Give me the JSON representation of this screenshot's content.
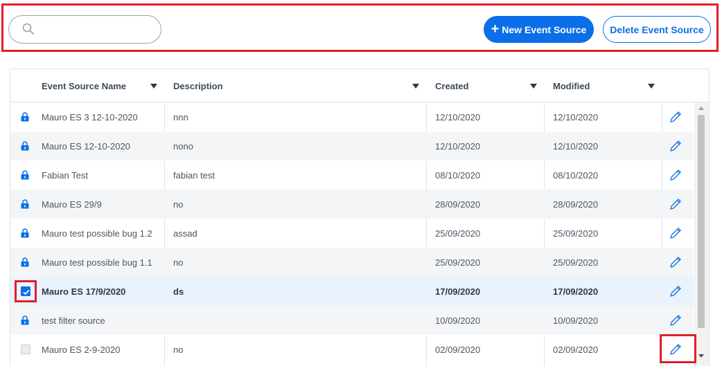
{
  "toolbar": {
    "search_placeholder": "",
    "search_value": "",
    "new_button_icon": "plus-icon",
    "new_button_label": "New Event Source",
    "delete_button_label": "Delete Event Source"
  },
  "table": {
    "columns": [
      {
        "label": "Event Source Name"
      },
      {
        "label": "Description"
      },
      {
        "label": "Created"
      },
      {
        "label": "Modified"
      }
    ],
    "rows": [
      {
        "name": "Mauro ES 3 12-10-2020",
        "description": "nnn",
        "created": "12/10/2020",
        "modified": "12/10/2020",
        "marker": "lock-icon"
      },
      {
        "name": "Mauro ES 12-10-2020",
        "description": "nono",
        "created": "12/10/2020",
        "modified": "12/10/2020",
        "marker": "lock-icon"
      },
      {
        "name": "Fabian Test",
        "description": "fabian test",
        "created": "08/10/2020",
        "modified": "08/10/2020",
        "marker": "lock-icon"
      },
      {
        "name": "Mauro ES 29/9",
        "description": "no",
        "created": "28/09/2020",
        "modified": "28/09/2020",
        "marker": "lock-icon"
      },
      {
        "name": "Mauro test possible bug 1.2",
        "description": "assad",
        "created": "25/09/2020",
        "modified": "25/09/2020",
        "marker": "lock-icon"
      },
      {
        "name": "Mauro test possible bug 1.1",
        "description": "no",
        "created": "25/09/2020",
        "modified": "25/09/2020",
        "marker": "lock-icon"
      },
      {
        "name": "Mauro ES 17/9/2020",
        "description": "ds",
        "created": "17/09/2020",
        "modified": "17/09/2020",
        "marker": "checkbox-checked"
      },
      {
        "name": "test filter source",
        "description": "",
        "created": "10/09/2020",
        "modified": "10/09/2020",
        "marker": "lock-icon"
      },
      {
        "name": "Mauro ES 2-9-2020",
        "description": "no",
        "created": "02/09/2020",
        "modified": "02/09/2020",
        "marker": "checkbox-unchecked"
      }
    ]
  },
  "colors": {
    "accent": "#0a6fe8",
    "highlight": "#e21d2a",
    "row_alt": "#f4f5f7",
    "row_selected": "#eaf2fb"
  }
}
